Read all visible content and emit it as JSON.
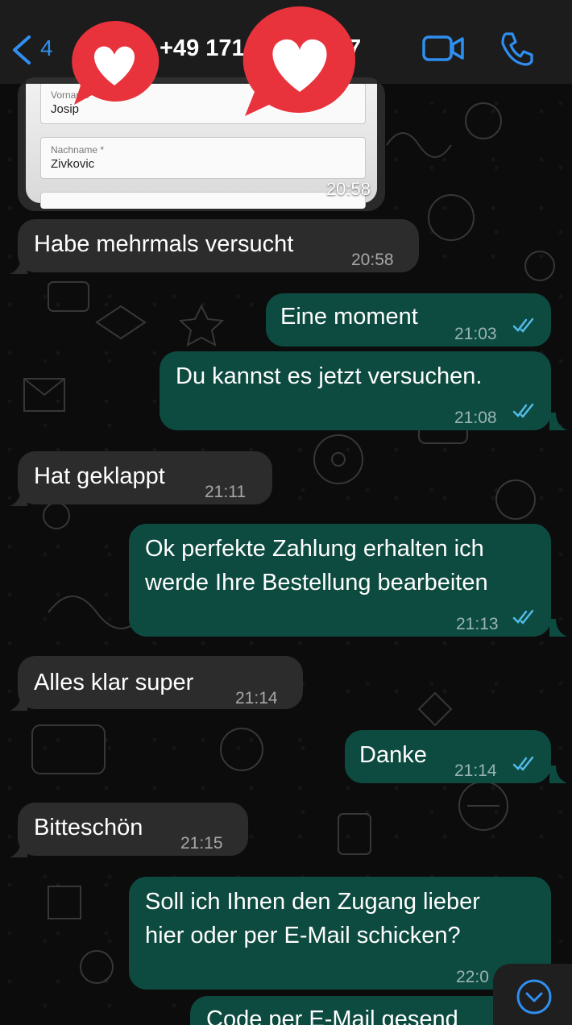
{
  "header": {
    "back_count": "4",
    "contact_name_visible": "+49 171",
    "contact_name_tail": "7"
  },
  "image_preview": {
    "fields": [
      {
        "label": "Vorname *",
        "value": "Josip"
      },
      {
        "label": "Nachname *",
        "value": "Zivkovic"
      }
    ],
    "time": "20:58"
  },
  "messages": [
    {
      "dir": "in",
      "text": "Habe mehrmals versucht",
      "time": "20:58"
    },
    {
      "dir": "out",
      "text": "Eine moment",
      "time": "21:03"
    },
    {
      "dir": "out",
      "text": "Du kannst es jetzt versuchen.",
      "time": "21:08"
    },
    {
      "dir": "in",
      "text": "Hat geklappt",
      "time": "21:11"
    },
    {
      "dir": "out",
      "text_lines": [
        "Ok perfekte Zahlung erhalten ich",
        "werde Ihre Bestellung bearbeiten"
      ],
      "time": "21:13"
    },
    {
      "dir": "in",
      "text": "Alles klar super",
      "time": "21:14"
    },
    {
      "dir": "out",
      "text": "Danke",
      "time": "21:14"
    },
    {
      "dir": "in",
      "text": "Bitteschön",
      "time": "21:15"
    },
    {
      "dir": "out",
      "text_lines": [
        "Soll ich Ihnen den Zugang lieber",
        "hier oder per E-Mail schicken?"
      ],
      "time": "22:0"
    },
    {
      "dir": "out",
      "text": "Code per E-Mail gesend"
    }
  ],
  "colors": {
    "incoming_bubble": "#2c2c2c",
    "outgoing_bubble": "#0d4b41",
    "accent": "#2f8ff0",
    "read_ticks": "#53bdeb",
    "heart_sticker": "#e8333d"
  },
  "icons": [
    "back-chevron-icon",
    "video-call-icon",
    "phone-call-icon",
    "heart-sticker-icon",
    "double-check-icon",
    "chevron-down-icon"
  ]
}
